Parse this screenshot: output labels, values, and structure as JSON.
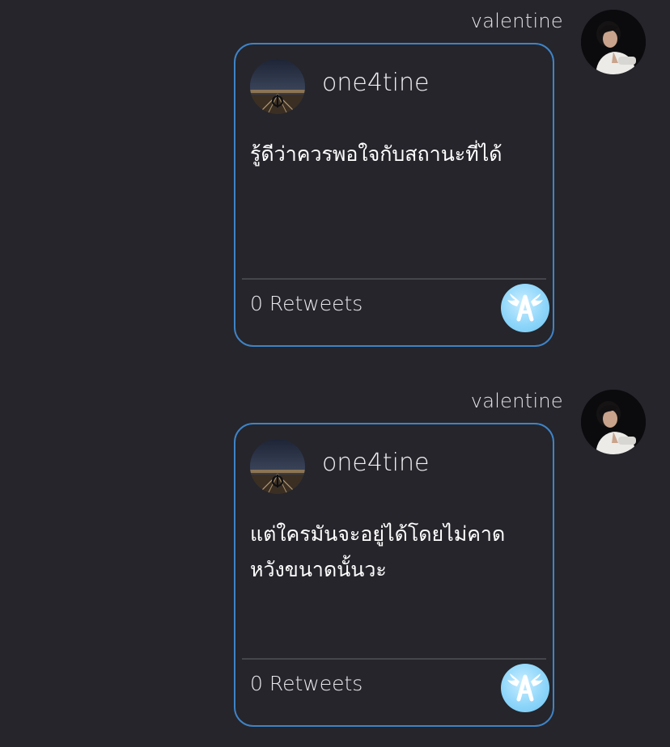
{
  "messages": [
    {
      "sender": "valentine",
      "card": {
        "author": "one4tine",
        "text": "รู้ดีว่าควรพอใจกับสถานะที่ได้",
        "retweets": "0 Retweets"
      }
    },
    {
      "sender": "valentine",
      "card": {
        "author": "one4tine",
        "text": "แต่ใครมันจะอยู่ได้โดยไม่คาด\nหวังขนาดนั้นวะ",
        "retweets": "0 Retweets"
      }
    }
  ],
  "colors": {
    "background": "#25252b",
    "card_border": "#3f83c6",
    "badge": "#8fd6fa"
  },
  "icons": {
    "app_badge": "winged-a-app-icon",
    "sender_avatar": "user-avatar-photo",
    "author_avatar": "night-scene-avatar-photo"
  }
}
